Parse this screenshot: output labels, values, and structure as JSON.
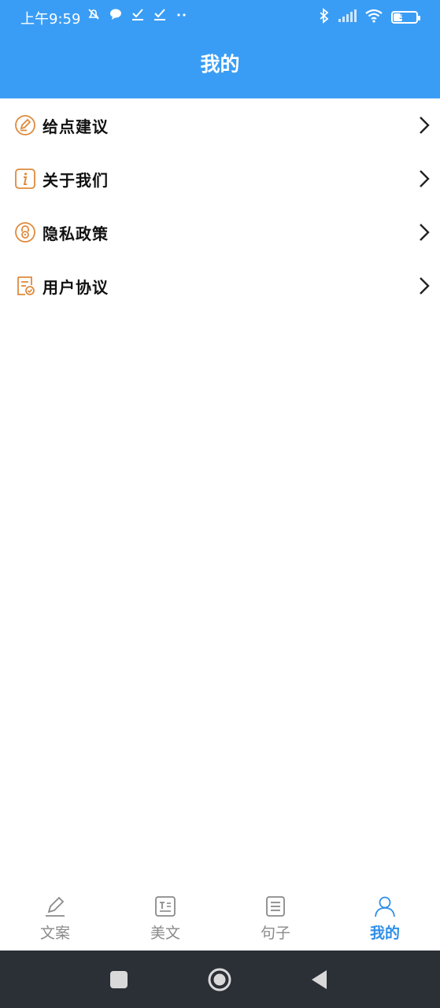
{
  "status_bar": {
    "time": "上午9:59",
    "battery_level": "37"
  },
  "header": {
    "title": "我的"
  },
  "menu": {
    "items": [
      {
        "label": "给点建议",
        "icon": "edit-circle-icon"
      },
      {
        "label": "关于我们",
        "icon": "info-icon"
      },
      {
        "label": "隐私政策",
        "icon": "lock-circle-icon"
      },
      {
        "label": "用户协议",
        "icon": "document-check-icon"
      }
    ]
  },
  "tabbar": {
    "tabs": [
      {
        "label": "文案",
        "icon": "pencil-icon",
        "active": false
      },
      {
        "label": "美文",
        "icon": "text-box-icon",
        "active": false
      },
      {
        "label": "句子",
        "icon": "list-doc-icon",
        "active": false
      },
      {
        "label": "我的",
        "icon": "person-icon",
        "active": true
      }
    ]
  },
  "colors": {
    "header_bg": "#3a9df5",
    "accent_orange": "#e08a3c",
    "tab_active": "#2f8fe8",
    "tab_inactive": "#8a8a8a",
    "navbar_bg": "#2b2f36"
  }
}
